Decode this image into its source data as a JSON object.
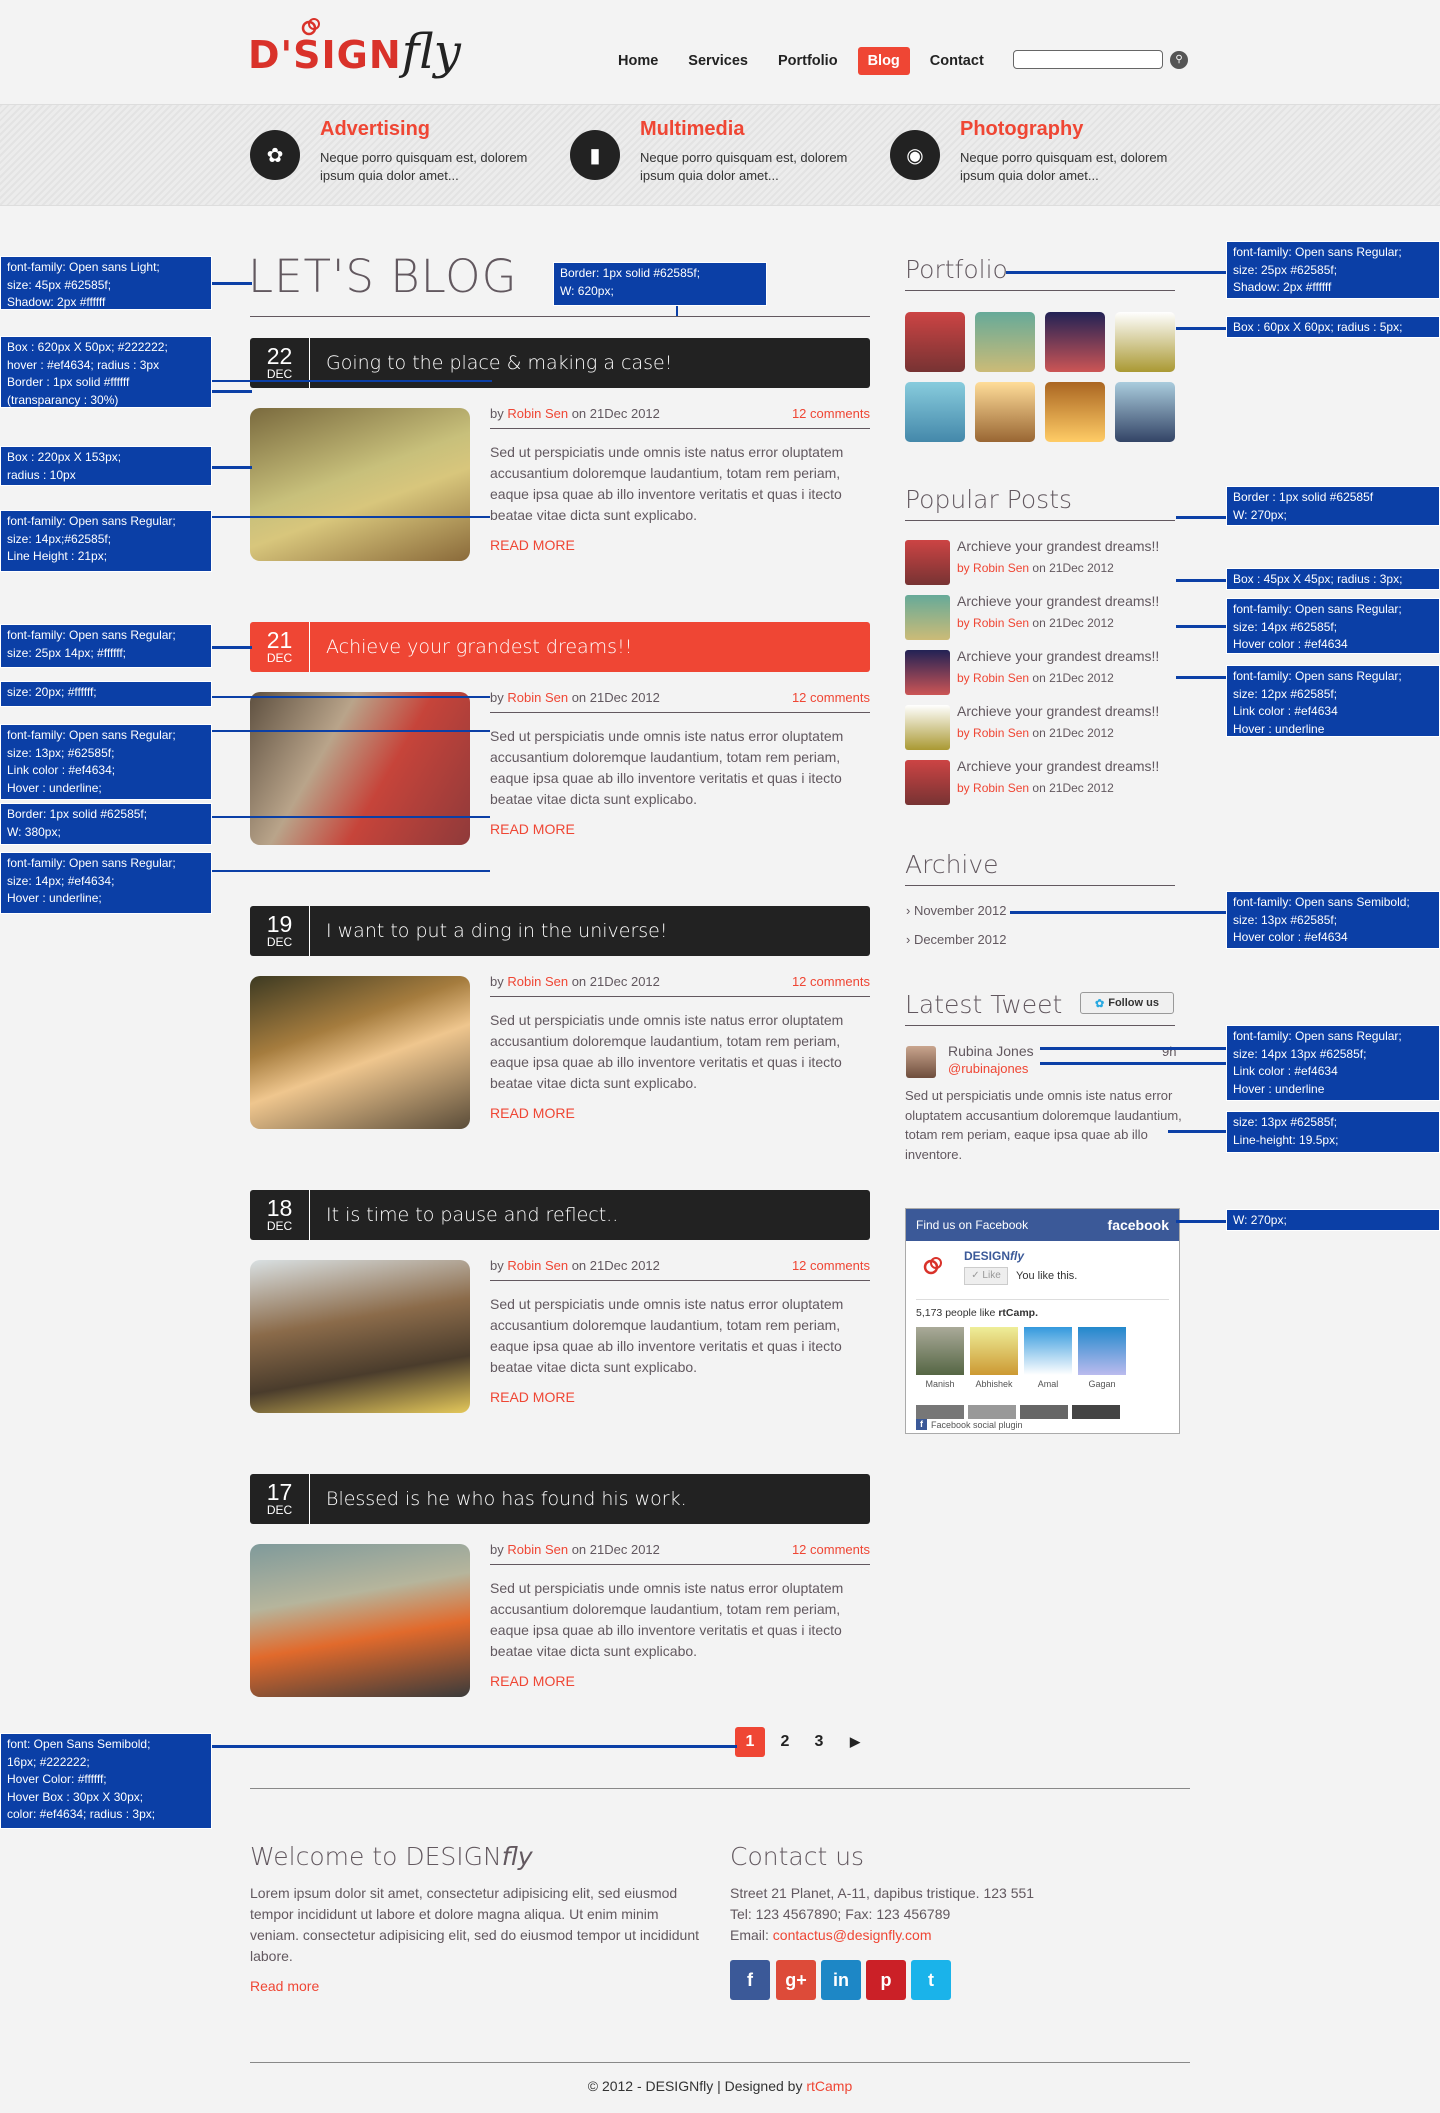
{
  "header": {
    "logo_main": "D'SIGN",
    "logo_fly": "fly",
    "nav": [
      "Home",
      "Services",
      "Portfolio",
      "Blog",
      "Contact"
    ],
    "active_nav": "Blog"
  },
  "services": [
    {
      "title": "Advertising",
      "text": "Neque porro quisquam est, dolorem ipsum quia dolor amet...",
      "icon": "leaf-icon"
    },
    {
      "title": "Multimedia",
      "text": "Neque porro quisquam est, dolorem ipsum quia dolor amet...",
      "icon": "mobile-icon"
    },
    {
      "title": "Photography",
      "text": "Neque porro quisquam est, dolorem ipsum quia dolor amet...",
      "icon": "camera-icon"
    }
  ],
  "blog": {
    "heading": "LET'S BLOG",
    "posts": [
      {
        "day": "22",
        "month": "DEC",
        "title": "Going to the place & making a case!",
        "highlight": false,
        "author": "Robin Sen",
        "date": "on 21Dec 2012",
        "comments": "12 comments",
        "excerpt": "Sed ut perspiciatis unde omnis iste natus error oluptatem accusantium doloremque laudantium, totam rem periam, eaque ipsa quae ab illo inventore veritatis et quas i itecto beatae vitae dicta sunt explicabo.",
        "readmore": "READ MORE"
      },
      {
        "day": "21",
        "month": "DEC",
        "title": "Achieve your grandest dreams!!",
        "highlight": true,
        "author": "Robin Sen",
        "date": "on 21Dec 2012",
        "comments": "12 comments",
        "excerpt": "Sed ut perspiciatis unde omnis iste natus error oluptatem accusantium doloremque laudantium, totam rem periam, eaque ipsa quae ab illo inventore veritatis et quas i itecto beatae vitae dicta sunt explicabo.",
        "readmore": "READ MORE"
      },
      {
        "day": "19",
        "month": "DEC",
        "title": "I want to put a ding in the universe!",
        "highlight": false,
        "author": "Robin Sen",
        "date": "on 21Dec 2012",
        "comments": "12 comments",
        "excerpt": "Sed ut perspiciatis unde omnis iste natus error oluptatem accusantium doloremque laudantium, totam rem periam, eaque ipsa quae ab illo inventore veritatis et quas i itecto beatae vitae dicta sunt explicabo.",
        "readmore": "READ MORE"
      },
      {
        "day": "18",
        "month": "DEC",
        "title": "It is time to pause and reflect..",
        "highlight": false,
        "author": "Robin Sen",
        "date": "on 21Dec 2012",
        "comments": "12 comments",
        "excerpt": "Sed ut perspiciatis unde omnis iste natus error oluptatem accusantium doloremque laudantium, totam rem periam, eaque ipsa quae ab illo inventore veritatis et quas i itecto beatae vitae dicta sunt explicabo.",
        "readmore": "READ MORE"
      },
      {
        "day": "17",
        "month": "DEC",
        "title": "Blessed is he who has found his work.",
        "highlight": false,
        "author": "Robin Sen",
        "date": "on 21Dec 2012",
        "comments": "12 comments",
        "excerpt": "Sed ut perspiciatis unde omnis iste natus error oluptatem accusantium doloremque laudantium, totam rem periam, eaque ipsa quae ab illo inventore veritatis et quas i itecto beatae vitae dicta sunt explicabo.",
        "readmore": "READ MORE"
      }
    ],
    "by_label": "by"
  },
  "pagination": {
    "pages": [
      "1",
      "2",
      "3"
    ],
    "next": "▶"
  },
  "sidebar": {
    "portfolio_title": "Portfolio",
    "popular_title": "Popular Posts",
    "popular_posts": [
      {
        "title": "Archieve your grandest dreams!!",
        "author": "Robin Sen",
        "date": "on 21Dec 2012"
      },
      {
        "title": "Archieve your grandest dreams!!",
        "author": "Robin Sen",
        "date": "on 21Dec 2012"
      },
      {
        "title": "Archieve your grandest dreams!!",
        "author": "Robin Sen",
        "date": "on 21Dec 2012"
      },
      {
        "title": "Archieve your grandest dreams!!",
        "author": "Robin Sen",
        "date": "on 21Dec 2012"
      },
      {
        "title": "Archieve your grandest dreams!!",
        "author": "Robin Sen",
        "date": "on 21Dec 2012"
      }
    ],
    "archive_title": "Archive",
    "archive": [
      "› November 2012",
      "› December 2012"
    ],
    "tweet_title": "Latest Tweet",
    "follow_label": "Follow us",
    "tweet": {
      "name": "Rubina Jones",
      "time": "9h",
      "handle": "@rubinajones",
      "text": "Sed ut perspiciatis unde omnis iste natus error oluptatem accusantium doloremque laudantium, totam rem periam, eaque ipsa quae ab illo inventore."
    },
    "facebook": {
      "header": "Find us on Facebook",
      "brand": "facebook",
      "page": "DESIGN",
      "page_fly": "fly",
      "like": "Like",
      "you_like": "You like this.",
      "count_text": "5,173 people like",
      "count_page": "rtCamp.",
      "fans": [
        "Manish",
        "Abhishek",
        "Amal",
        "Gagan"
      ],
      "plugin": "Facebook social plugin"
    }
  },
  "footer": {
    "welcome_title": "Welcome to DESIGN",
    "welcome_fly": "fly",
    "welcome_text": "Lorem ipsum dolor sit amet, consectetur adipisicing elit, sed  eiusmod tempor incididunt ut labore et dolore magna aliqua. Ut enim minim veniam. consectetur adipisicing elit, sed do eiusmod tempor ut incididunt labore.",
    "read_more": "Read more",
    "contact_title": "Contact us",
    "address": "Street 21 Planet, A-11, dapibus tristique. 123 551",
    "phone": "Tel: 123 4567890; Fax: 123 456789",
    "email_label": "Email: ",
    "email": "contactus@designfly.com",
    "social": [
      "f",
      "g+",
      "in",
      "p",
      "t"
    ],
    "copyright": "© 2012 - DESIGNfly | Designed by ",
    "credit": "rtCamp"
  },
  "annotations": {
    "title_font": "font-family: Open sans Light;\nsize:  45px #62585f;\nShadow: 2px #ffffff",
    "title_border": "Border: 1px solid #62585f;\nW: 620px;",
    "post_box": "Box : 620px X 50px; #222222;\nhover : #ef4634; radius : 3px\nBorder : 1px solid #ffffff\n(transparancy : 30%)",
    "thumb_box": "Box : 220px X 153px;\nradius : 10px",
    "body_font": "font-family: Open sans Regular;\nsize:  14px;#62585f;\nLine Height : 21px;",
    "date_font": "font-family: Open sans Regular;\nsize:  25px 14px; #ffffff;",
    "title_size": "size:  20px; #ffffff;",
    "meta_font": "font-family: Open sans Regular;\nsize:  13px; #62585f;\nLink color : #ef4634;\nHover : underline;",
    "meta_border": "Border: 1px solid #62585f;\nW: 380px;",
    "readmore_font": "font-family: Open sans Regular;\nsize:  14px; #ef4634;\nHover : underline;",
    "pagination": "font: Open Sans Semibold;\n16px; #222222;\nHover Color: #ffffff;\nHover Box : 30px X 30px;\ncolor: #ef4634;    radius : 3px;",
    "side_title": "font-family: Open sans Regular;\nsize:  25px #62585f;\nShadow: 2px #ffffff",
    "pf_box": "Box : 60px X 60px;  radius : 5px;",
    "pp_border": "Border : 1px solid #62585f\nW: 270px;",
    "pp_box": "Box : 45px X 45px;  radius : 3px;",
    "pp_title": "font-family: Open sans Regular;\nsize:  14px #62585f;\nHover color : #ef4634",
    "pp_meta": "font-family: Open sans Regular;\nsize:  12px #62585f;\nLink color : #ef4634\nHover : underline",
    "archive": "font-family: Open sans Semibold;\nsize:  13px #62585f;\nHover color : #ef4634",
    "tweet_name": "font-family: Open sans Regular;\nsize:  14px 13px #62585f;\nLink color : #ef4634\nHover : underline",
    "tweet_text": "size: 13px #62585f;\nLine-height: 19.5px;",
    "fb_w": "W: 270px;"
  }
}
